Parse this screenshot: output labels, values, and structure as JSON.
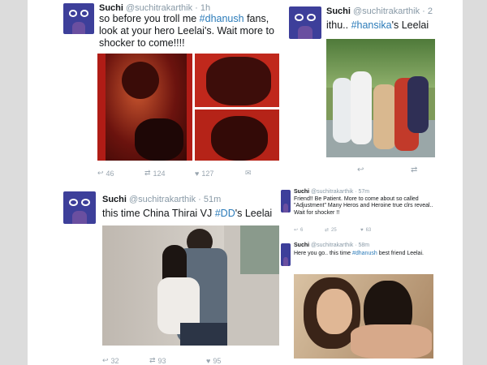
{
  "tweets": [
    {
      "name": "Suchi",
      "handle": "@suchitrakarthik",
      "time": "· 1h",
      "text_a": "so before you troll me ",
      "tag_a": "#dhanush",
      "text_b": " fans, look at your hero Leelai's. Wait more to shocker to come!!!!",
      "retweets": "124",
      "likes": "127",
      "replies": "46",
      "icons": [
        "reply-icon",
        "retweet-icon",
        "heart-icon",
        "more-icon"
      ]
    },
    {
      "name": "Suchi",
      "handle": "@suchitrakarthik",
      "time": "· 2",
      "text_a": "ithu.. ",
      "tag_a": "#hansika",
      "text_b": "'s Leelai",
      "icons": [
        "reply-icon",
        "retweet-icon"
      ]
    },
    {
      "name": "Suchi",
      "handle": "@suchitrakarthik",
      "time": "· 51m",
      "text_a": "this time China Thirai VJ ",
      "tag_a": "#DD",
      "text_b": "'s Leelai",
      "replies": "32",
      "retweets": "93",
      "likes": "95"
    },
    {
      "name": "Suchi",
      "handle": "@suchitrakarthik",
      "time": "· 57m",
      "text": "Friend!! Be Patient. More to come about so called \"Adjustment\" Many Heros and Heroine true clrs reveal.. Wait for shocker !!",
      "replies": "6",
      "retweets": "25",
      "likes": "63"
    },
    {
      "name": "Suchi",
      "handle": "@suchitrakarthik",
      "time": "· 58m",
      "text_a": "Here you go.. this time ",
      "tag_a": "#dhanush",
      "text_b": " best friend Leelai."
    }
  ],
  "colors": {
    "hashtag": "#2b7bb9",
    "muted": "#8899a6",
    "avatar": "#3d3f9a"
  }
}
